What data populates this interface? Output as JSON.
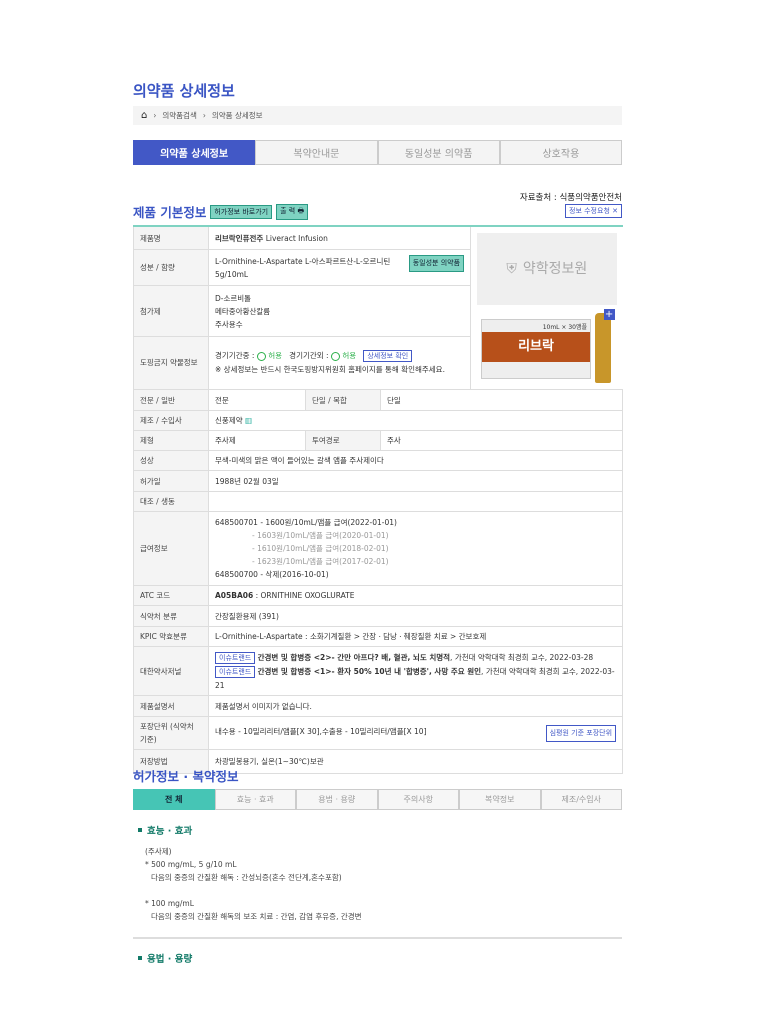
{
  "page_title": "의약품 상세정보",
  "breadcrumb": [
    "의약품검색",
    "의약품 상세정보"
  ],
  "tabs": [
    "의약품 상세정보",
    "복약안내문",
    "동일성분 의약품",
    "상호작용"
  ],
  "source": "자료출처 : 식품의약품안전처",
  "basic": {
    "title": "제품 기본정보",
    "permit_btn": "허가정보 바로가기",
    "print_btn": "출 력",
    "fix_btn": "정보 수정요청",
    "logo_text": "약학정보원"
  },
  "rows": {
    "name": {
      "label": "제품명",
      "value": "리브락인퓨전주",
      "en": "Liveract Infusion"
    },
    "ingredient": {
      "label": "성분 / 함량",
      "value": "L-Ornithine-L-Aspartate   L-아스파르트산-L-오르니틴",
      "amount": "5g/10mL",
      "btn": "동일성분 의약품"
    },
    "additive": {
      "label": "첨가제",
      "values": [
        "D-소르비톨",
        "메타중아황산칼륨",
        "주사용수"
      ]
    },
    "doping": {
      "label": "도핑금지 약물정보",
      "in": "경기기간중 :",
      "in_v": "허용",
      "out": "경기기간외 :",
      "out_v": "허용",
      "btn": "상세정보 확인",
      "note": "※ 상세정보는 반드시 한국도핑방지위원회 홈페이지를 통해 확인해주세요."
    },
    "type": {
      "label": "전문 / 일반",
      "value": "전문",
      "label2": "단일 / 복합",
      "value2": "단일"
    },
    "maker": {
      "label": "제조 / 수입사",
      "value": "신풍제약"
    },
    "form": {
      "label": "제형",
      "value": "주사제",
      "label2": "투여경로",
      "value2": "주사"
    },
    "appearance": {
      "label": "성상",
      "value": "무색-미색의 맑은 액이 들어있는 갈색 앰플 주사제이다"
    },
    "date": {
      "label": "허가일",
      "value": "1988년 02월 03일"
    },
    "generic": {
      "label": "대조 / 생동",
      "value": ""
    },
    "insurance": {
      "label": "급여정보",
      "lines": [
        "648500701 - 1600원/10mL/앰플 급여(2022-01-01)",
        "- 1603원/10mL/앰플 급여(2020-01-01)",
        "- 1610원/10mL/앰플 급여(2018-02-01)",
        "- 1623원/10mL/앰플 급여(2017-02-01)",
        "648500700 - 삭제(2016-10-01)"
      ]
    },
    "atc": {
      "label": "ATC 코드",
      "code": "A05BA06",
      "value": " : ORNITHINE OXOGLURATE"
    },
    "mfds": {
      "label": "식약처 분류",
      "value": "간장질환용제 (391)"
    },
    "kpic": {
      "label": "KPIC 약효분류",
      "value": "L-Ornithine-L-Aspartate : 소화기계질환 > 간장ㆍ담낭ㆍ췌장질환 치료 > 간보호제"
    },
    "journal": {
      "label": "대한약사저널",
      "tag": "이슈트랜드",
      "items": [
        {
          "title": "간경변 및 합병증 <2>- 간만 아프다? 배, 혈관, 뇌도 치명적",
          "meta": ", 가천대 약학대학 최경희 교수, 2022-03-28"
        },
        {
          "title": "간경변 및 합병증 <1>- 환자 50% 10년 내 '합병증', 사망 주요 원인",
          "meta": ", 가천대 약학대학 최경희 교수, 2022-03-21"
        }
      ]
    },
    "leaflet": {
      "label": "제품설명서",
      "value": "제품설명서 이미지가 없습니다."
    },
    "package": {
      "label": "포장단위 (식약처 기준)",
      "value": "내수용 - 10밀리리터/앰플[X 30],수출용 - 10밀리리터/앰플[X 10]",
      "btn": "심평원 기준 포장단위"
    },
    "storage": {
      "label": "저장방법",
      "value": "차광밀봉용기, 실온(1~30℃)보관"
    }
  },
  "product_image": {
    "brand": "리브락",
    "spec": "10mL × 30앰플"
  },
  "permit": {
    "title": "허가정보 · 복약정보",
    "tabs": [
      "전 체",
      "효능 · 효과",
      "용법 · 용량",
      "주의사항",
      "복약정보",
      "제조/수입사"
    ],
    "effect_title": "효능 · 효과",
    "effect_lines": [
      "(주사제)",
      "* 500 mg/mL, 5 g/10 mL",
      "   다음의 중증의 간질환 해독 : 간성뇌증(혼수 전단계,혼수포함)",
      "",
      "* 100 mg/mL",
      "   다음의 중증의 간질환 해독의 보조 치료 : 간염, 감염 후유증, 간경변"
    ],
    "dosage_title": "용법 · 용량"
  }
}
